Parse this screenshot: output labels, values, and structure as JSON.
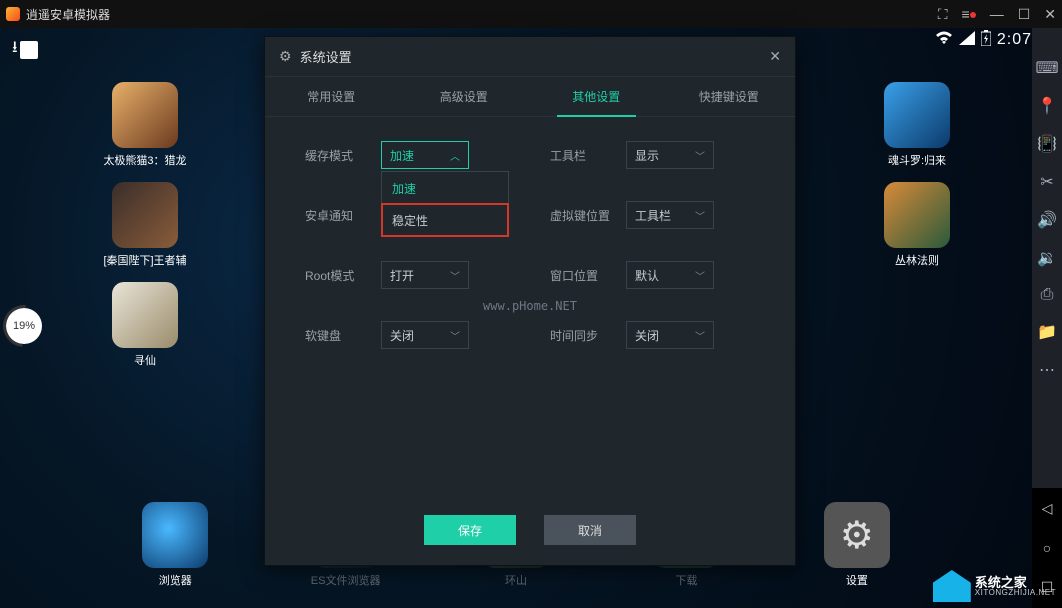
{
  "titlebar": {
    "title": "逍遥安卓模拟器"
  },
  "statusbar": {
    "time": "2:07"
  },
  "progress": {
    "percent": "19%"
  },
  "sidebar_apps_left": [
    {
      "label": "太极熊猫3：猎龙"
    },
    {
      "label": "[秦国陛下]王者辅"
    },
    {
      "label": "寻仙"
    }
  ],
  "sidebar_apps_right": [
    {
      "label": "魂斗罗:归来"
    },
    {
      "label": "丛林法则"
    }
  ],
  "bottom_apps": [
    {
      "label": "浏览器"
    },
    {
      "label": "ES文件浏览器"
    },
    {
      "label": "环山"
    },
    {
      "label": "下载"
    },
    {
      "label": "设置"
    }
  ],
  "modal": {
    "title": "系统设置",
    "tabs": [
      "常用设置",
      "高级设置",
      "其他设置",
      "快捷键设置"
    ],
    "active_tab": 2,
    "rows_left": [
      {
        "label": "缓存模式",
        "value": "加速",
        "open": true
      },
      {
        "label": "安卓通知",
        "value": ""
      },
      {
        "label": "Root模式",
        "value": "打开"
      },
      {
        "label": "软键盘",
        "value": "关闭"
      }
    ],
    "rows_right": [
      {
        "label": "工具栏",
        "value": "显示"
      },
      {
        "label": "虚拟键位置",
        "value": "工具栏"
      },
      {
        "label": "窗口位置",
        "value": "默认"
      },
      {
        "label": "时间同步",
        "value": "关闭"
      }
    ],
    "dropdown_options": [
      "加速",
      "稳定性"
    ],
    "watermark": "www.pHome.NET",
    "buttons": {
      "save": "保存",
      "cancel": "取消"
    }
  },
  "corner": {
    "main": "系统之家",
    "sub": "XITONGZHIJIA.NET"
  }
}
